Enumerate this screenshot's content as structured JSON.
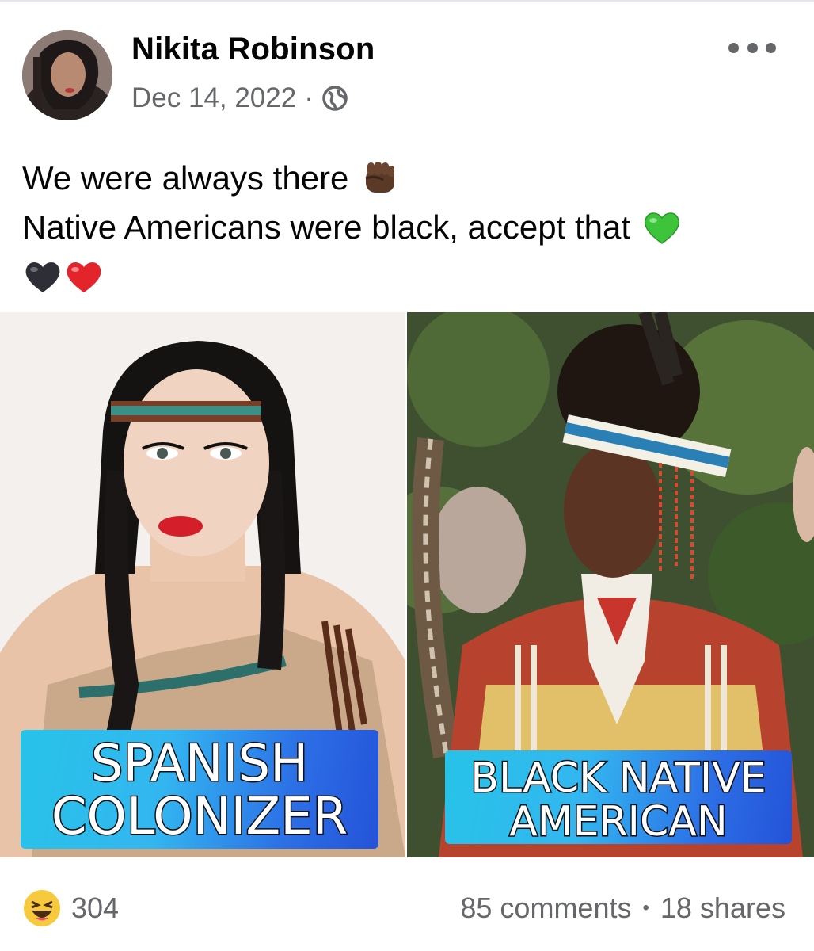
{
  "post": {
    "author": "Nikita Robinson",
    "date": "Dec 14, 2022",
    "meta_separator": "·",
    "privacy_icon": "globe-icon",
    "menu_icon": "more-options-icon",
    "text_line_1": "We were always there",
    "text_line_2": "Native Americans were black, accept that",
    "emojis": [
      "raised-fist-dark-skin-emoji",
      "green-heart-emoji",
      "black-heart-emoji",
      "red-heart-emoji"
    ]
  },
  "images": {
    "left_caption_line_1": "SPANISH",
    "left_caption_line_2": "COLONIZER",
    "right_caption_line_1": "BLACK NATIVE",
    "right_caption_line_2": "AMERICAN"
  },
  "footer": {
    "reaction_icon": "haha-emoji-icon",
    "reaction_count": "304",
    "comments": "85 comments",
    "separator": "•",
    "shares": "18 shares"
  },
  "colors": {
    "secondary_text": "#65676b",
    "caption_gradient_start": "#27c3e8",
    "caption_gradient_end": "#2453d8"
  }
}
